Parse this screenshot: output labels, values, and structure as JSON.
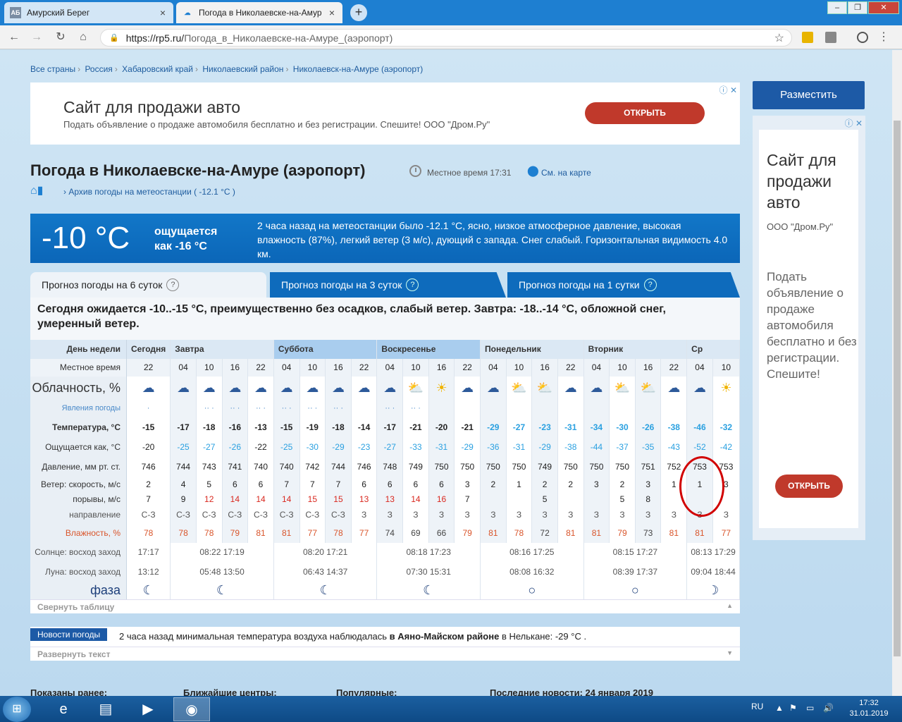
{
  "browser": {
    "tabs": [
      {
        "title": "Амурский Берег",
        "favicon": "АБ"
      },
      {
        "title": "Погода в Николаевске-на-Амур",
        "favicon": "☁"
      }
    ],
    "url_host": "https://rp5.ru/",
    "url_path": "Погода_в_Николаевске-на-Амуре_(аэропорт)"
  },
  "breadcrumbs": [
    "Все страны",
    "Россия",
    "Хабаровский край",
    "Николаевский район",
    "Николаевск-на-Амуре (аэропорт)"
  ],
  "ad_top": {
    "title": "Сайт для продажи авто",
    "subtitle": "Подать объявление о продаже автомобиля бесплатно и без регистрации. Спешите! ООО \"Дром.Ру\"",
    "button": "ОТКРЫТЬ"
  },
  "ad_right": {
    "place_button": "Разместить",
    "title": "Сайт для продажи авто",
    "sponsor": "ООО \"Дром.Ру\"",
    "description": "Подать объявление о продаже автомобиля бесплатно и без регистрации. Спешите!",
    "button": "ОТКРЫТЬ"
  },
  "header": {
    "title": "Погода в Николаевске-на-Амуре (аэропорт)",
    "local_time": "Местное время  17:31",
    "map_link": "См. на карте",
    "archive": "Архив погоды на метеостанции ( -12.1 °C )"
  },
  "now": {
    "temp": "-10 °C",
    "feels": "ощущается как -16 °C",
    "description": "2 часа назад на метеостанции было -12.1 °C, ясно, низкое атмосферное давление, высокая влажность (87%), легкий ветер (3 м/с), дующий с запада. Снег слабый. Горизонтальная видимость 4.0 км."
  },
  "forecast_tabs": [
    "Прогноз погоды на 6 суток",
    "Прогноз погоды на 3 суток",
    "Прогноз погоды на 1 сутки"
  ],
  "summary": "Сегодня ожидается -10..-15 °C, преимущественно без осадков, слабый ветер. Завтра: -18..-14 °C, обложной снег, умеренный ветер.",
  "table": {
    "labels": {
      "day": "День недели",
      "time": "Местное время",
      "cloud": "Облачность, %",
      "phen": "Явления погоды",
      "temp": "Температура, °C",
      "feels": "Ощущается как, °C",
      "press": "Давление, мм рт. ст.",
      "wind": "Ветер: скорость, м/с",
      "gust": "порывы, м/с",
      "dir": "направление",
      "hum": "Влажность, %",
      "sun": "Солнце: восход заход",
      "moon": "Луна: восход заход",
      "phase": "фаза"
    },
    "days": [
      "Сегодня",
      "Завтра",
      "Суббота",
      "Воскресенье",
      "Понедельник",
      "Вторник",
      "Ср"
    ],
    "times": [
      "22",
      "04",
      "10",
      "16",
      "22",
      "04",
      "10",
      "16",
      "22",
      "04",
      "10",
      "16",
      "22",
      "04",
      "10",
      "16",
      "22",
      "04",
      "10",
      "16",
      "22",
      "04",
      "10"
    ],
    "temp": [
      "-15",
      "-17",
      "-18",
      "-16",
      "-13",
      "-15",
      "-19",
      "-18",
      "-14",
      "-17",
      "-21",
      "-20",
      "-21",
      "-29",
      "-27",
      "-23",
      "-31",
      "-34",
      "-30",
      "-26",
      "-38",
      "-46",
      "-32"
    ],
    "feels": [
      "-20",
      "-25",
      "-27",
      "-26",
      "-22",
      "-25",
      "-30",
      "-29",
      "-23",
      "-27",
      "-33",
      "-31",
      "-29",
      "-36",
      "-31",
      "-29",
      "-38",
      "-44",
      "-37",
      "-35",
      "-43",
      "-52",
      "-42"
    ],
    "press": [
      "746",
      "744",
      "743",
      "741",
      "740",
      "740",
      "742",
      "744",
      "746",
      "748",
      "749",
      "750",
      "750",
      "750",
      "750",
      "749",
      "750",
      "750",
      "750",
      "751",
      "752",
      "753",
      "753"
    ],
    "wind": [
      "2",
      "4",
      "5",
      "6",
      "6",
      "7",
      "7",
      "7",
      "6",
      "6",
      "6",
      "6",
      "3",
      "2",
      "1",
      "2",
      "2",
      "3",
      "2",
      "3",
      "1",
      "1",
      "3"
    ],
    "gust": [
      "7",
      "9",
      "12",
      "14",
      "14",
      "14",
      "15",
      "15",
      "13",
      "13",
      "14",
      "16",
      "7",
      "",
      "",
      "5",
      "",
      "",
      "5",
      "8",
      "",
      "",
      ""
    ],
    "dir": [
      "С-З",
      "С-З",
      "С-З",
      "С-З",
      "С-З",
      "С-З",
      "С-З",
      "С-З",
      "З",
      "З",
      "З",
      "З",
      "З",
      "З",
      "З",
      "З",
      "З",
      "З",
      "З",
      "З",
      "З",
      "З",
      "З"
    ],
    "hum": [
      "78",
      "78",
      "78",
      "79",
      "81",
      "81",
      "77",
      "78",
      "77",
      "74",
      "69",
      "66",
      "79",
      "81",
      "78",
      "72",
      "81",
      "81",
      "79",
      "73",
      "81",
      "81",
      "77"
    ],
    "sun": [
      "17:17",
      "08:22  17:19",
      "08:20  17:21",
      "08:18  17:23",
      "08:16  17:25",
      "08:15  17:27",
      "08:13  17:29"
    ],
    "moon": [
      "13:12",
      "05:48  13:50",
      "06:43  14:37",
      "07:30  15:31",
      "08:08  16:32",
      "08:39  17:37",
      "09:04  18:44"
    ],
    "phases": [
      "☾",
      "☾",
      "☾",
      "☾",
      "○",
      "○",
      "☽"
    ],
    "sky_icons": [
      "☁",
      "☁",
      "☁",
      "☁",
      "☁",
      "☁",
      "☁",
      "☁",
      "☁",
      "☁",
      "⛅",
      "☀",
      "☁",
      "☁",
      "⛅",
      "⛅",
      "☁",
      "☁",
      "⛅",
      "⛅",
      "☁",
      "☁",
      "☀"
    ],
    "phen_marks": [
      "·",
      "",
      "·· ·",
      "·· ·",
      "·· ·",
      "·· ·",
      "·· ·",
      "·· ·",
      "",
      "·· ·",
      "·· ·",
      "",
      "",
      "",
      "",
      "",
      "",
      "",
      "",
      "",
      "",
      "",
      ""
    ]
  },
  "collapse_label": "Свернуть таблицу",
  "news": {
    "tag": "Новости погоды",
    "text_before": "2 часа назад минимальная температура воздуха наблюдалась ",
    "text_bold": "в Аяно-Майском районе",
    "text_after": " в Нелькане: -29 °C ."
  },
  "expand_label": "Развернуть текст",
  "bottom_headers": [
    "Показаны ранее:",
    "Ближайшие центры:",
    "Популярные:",
    "Последние новости: 24 января 2019"
  ],
  "taskbar": {
    "lang": "RU",
    "time": "17:32",
    "date": "31.01.2019"
  }
}
